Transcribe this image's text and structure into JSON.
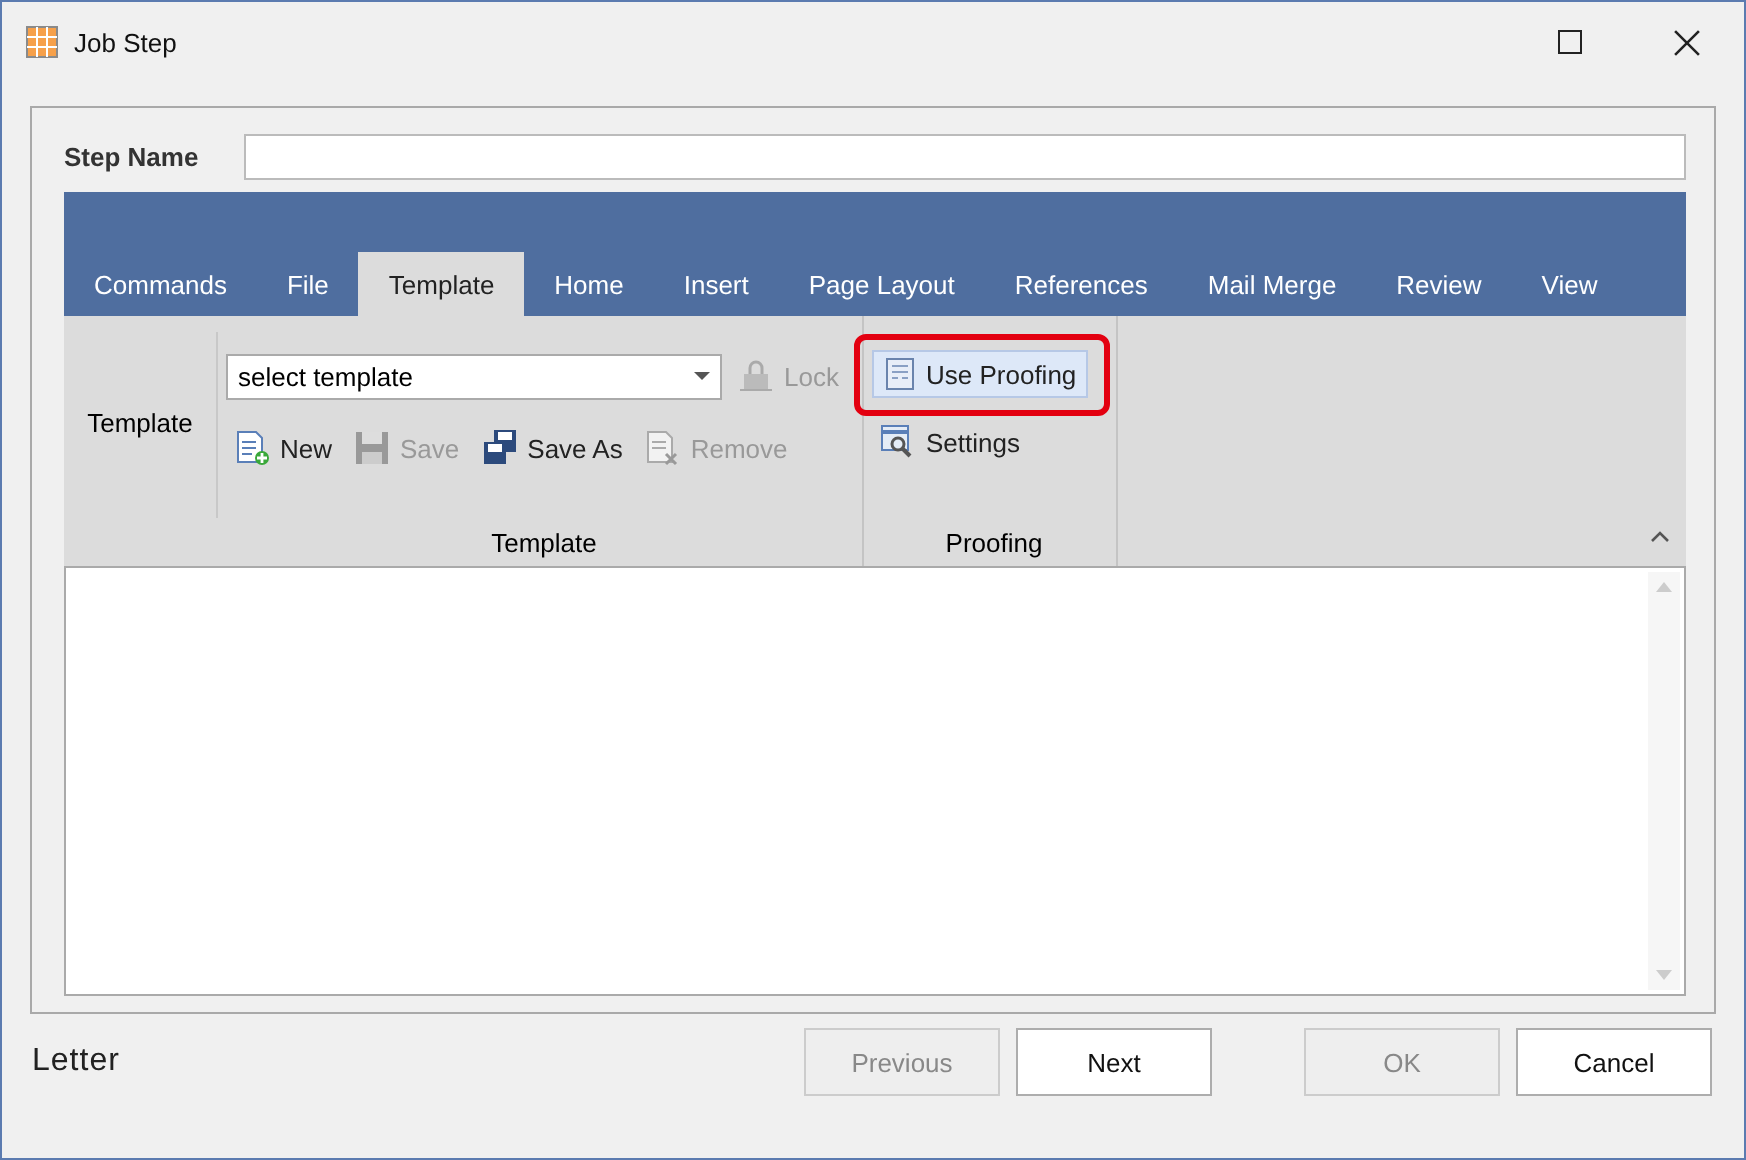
{
  "window": {
    "title": "Job Step"
  },
  "step_name": {
    "label": "Step Name"
  },
  "tabs": [
    {
      "label": "Commands",
      "selected": false
    },
    {
      "label": "File",
      "selected": false
    },
    {
      "label": "Template",
      "selected": true
    },
    {
      "label": "Home",
      "selected": false
    },
    {
      "label": "Insert",
      "selected": false
    },
    {
      "label": "Page Layout",
      "selected": false
    },
    {
      "label": "References",
      "selected": false
    },
    {
      "label": "Mail Merge",
      "selected": false
    },
    {
      "label": "Review",
      "selected": false
    },
    {
      "label": "View",
      "selected": false
    }
  ],
  "template_group": {
    "side_label": "Template",
    "dropdown": {
      "value": "select template"
    },
    "lock": {
      "label": "Lock",
      "disabled": true
    },
    "buttons": [
      {
        "kind": "new",
        "label": "New",
        "disabled": false
      },
      {
        "kind": "save",
        "label": "Save",
        "disabled": true
      },
      {
        "kind": "saveas",
        "label": "Save As",
        "disabled": false
      },
      {
        "kind": "remove",
        "label": "Remove",
        "disabled": true
      }
    ],
    "caption": "Template"
  },
  "proofing_group": {
    "use_proofing": {
      "label": "Use Proofing",
      "checked": true,
      "highlighted": true
    },
    "settings": {
      "label": "Settings"
    },
    "caption": "Proofing"
  },
  "footer": {
    "label": "Letter",
    "buttons": [
      {
        "label": "Previous",
        "disabled": true
      },
      {
        "label": "Next",
        "disabled": false
      },
      {
        "label": "OK",
        "disabled": true
      },
      {
        "label": "Cancel",
        "disabled": false
      }
    ]
  }
}
